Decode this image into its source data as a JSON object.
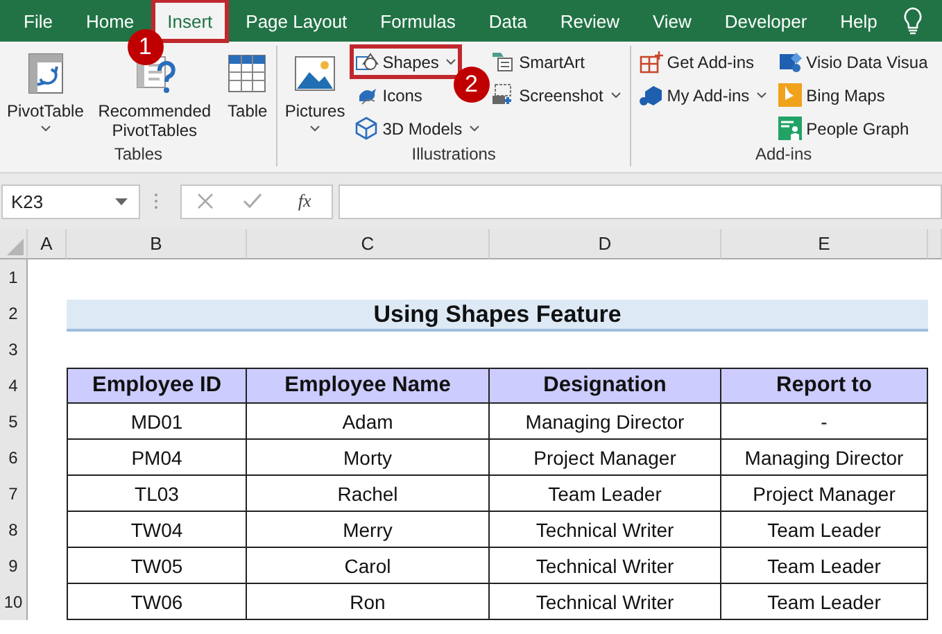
{
  "tabs": [
    {
      "label": "File",
      "selected": false
    },
    {
      "label": "Home",
      "selected": false
    },
    {
      "label": "Insert",
      "selected": true,
      "callout": "1"
    },
    {
      "label": "Page Layout",
      "selected": false
    },
    {
      "label": "Formulas",
      "selected": false
    },
    {
      "label": "Data",
      "selected": false
    },
    {
      "label": "Review",
      "selected": false
    },
    {
      "label": "View",
      "selected": false
    },
    {
      "label": "Developer",
      "selected": false
    },
    {
      "label": "Help",
      "selected": false
    }
  ],
  "ribbon": {
    "groups": [
      {
        "label": "Tables",
        "items": [
          {
            "kind": "large",
            "label": "PivotTable",
            "dropdown": true
          },
          {
            "kind": "large",
            "label": "Recommended PivotTables",
            "dropdown": false
          },
          {
            "kind": "large",
            "label": "Table",
            "dropdown": false
          }
        ]
      },
      {
        "label": "Illustrations",
        "items": [
          {
            "kind": "large",
            "label": "Pictures",
            "dropdown": true
          },
          {
            "kind": "stack",
            "commands": [
              {
                "label": "Shapes",
                "dropdown": true,
                "callout": "2"
              },
              {
                "label": "Icons",
                "dropdown": false
              },
              {
                "label": "3D Models",
                "dropdown": true
              }
            ]
          },
          {
            "kind": "stack",
            "commands": [
              {
                "label": "SmartArt",
                "dropdown": false
              },
              {
                "label": "Screenshot",
                "dropdown": true
              }
            ]
          }
        ]
      },
      {
        "label": "Add-ins",
        "items": [
          {
            "kind": "stack",
            "commands": [
              {
                "label": "Get Add-ins",
                "dropdown": false
              },
              {
                "label": "My Add-ins",
                "dropdown": true
              }
            ]
          },
          {
            "kind": "stack",
            "commands": [
              {
                "label": "Visio Data Visua",
                "dropdown": false
              },
              {
                "label": "Bing Maps",
                "dropdown": false
              },
              {
                "label": "People Graph",
                "dropdown": false
              }
            ]
          }
        ]
      }
    ]
  },
  "formula_bar": {
    "name_box": "K23",
    "function_label": "fx"
  },
  "sheet": {
    "columns": [
      "A",
      "B",
      "C",
      "D",
      "E"
    ],
    "rows": [
      {
        "number": "1",
        "kind": "blank"
      },
      {
        "number": "2",
        "kind": "title",
        "text": "Using Shapes Feature"
      },
      {
        "number": "3",
        "kind": "blank"
      },
      {
        "number": "4",
        "kind": "header",
        "cells": [
          "Employee ID",
          "Employee Name",
          "Designation",
          "Report to"
        ]
      },
      {
        "number": "5",
        "kind": "data",
        "cells": [
          "MD01",
          "Adam",
          "Managing Director",
          "-"
        ]
      },
      {
        "number": "6",
        "kind": "data",
        "cells": [
          "PM04",
          "Morty",
          "Project Manager",
          "Managing Director"
        ]
      },
      {
        "number": "7",
        "kind": "data",
        "cells": [
          "TL03",
          "Rachel",
          "Team Leader",
          "Project Manager"
        ]
      },
      {
        "number": "8",
        "kind": "data",
        "cells": [
          "TW04",
          "Merry",
          "Technical Writer",
          "Team Leader"
        ]
      },
      {
        "number": "9",
        "kind": "data",
        "cells": [
          "TW05",
          "Carol",
          "Technical Writer",
          "Team Leader"
        ]
      },
      {
        "number": "10",
        "kind": "data",
        "cells": [
          "TW06",
          "Ron",
          "Technical Writer",
          "Team Leader"
        ]
      }
    ]
  }
}
